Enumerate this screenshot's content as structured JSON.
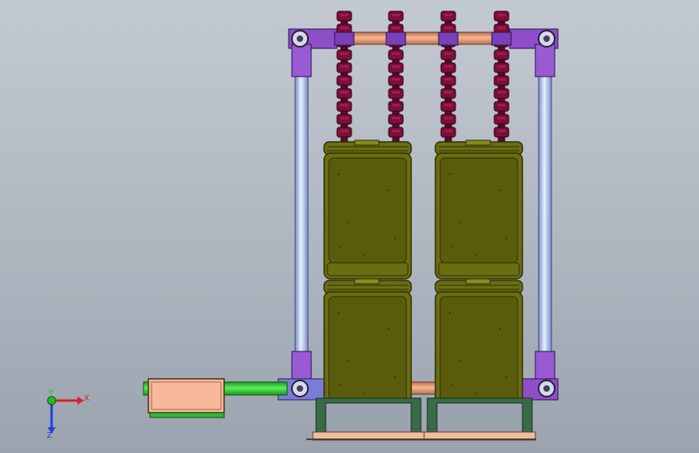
{
  "colors": {
    "tank_fill": "#6a6d10",
    "tank_edge": "#2e3006",
    "tank_inner": "#5a5c0c",
    "pipe_orange": "#e8a07c",
    "pipe_blue": "#c6d8f4",
    "fitting_purple": "#8e4ec8",
    "valve_maroon": "#7a1038",
    "pump_body": "#f8b89a",
    "pump_shaft": "#3ad43a",
    "base_green": "#2a5a3a",
    "base_plate": "#e8c0a0"
  },
  "triad": {
    "x_label": "X",
    "y_label": "Y",
    "z_label": "Z",
    "x_color": "#e02020",
    "y_color": "#20c020",
    "z_color": "#2040e0"
  }
}
